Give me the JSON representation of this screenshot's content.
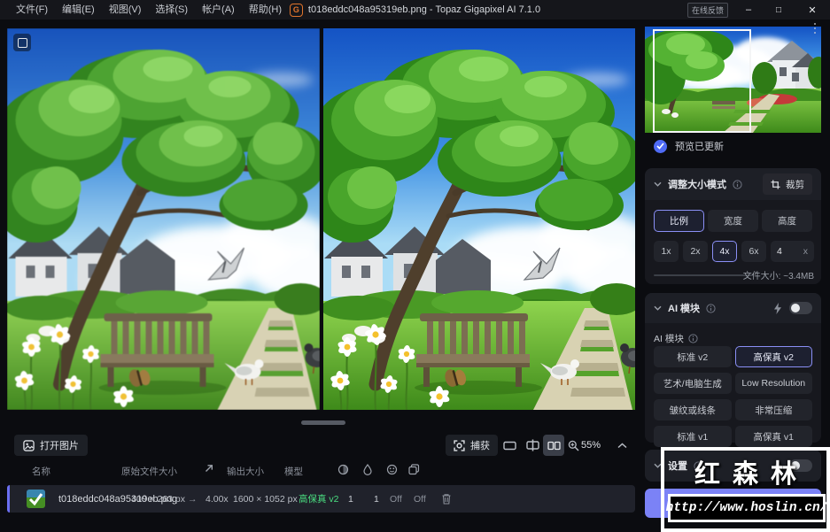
{
  "titlebar": {
    "menu": [
      {
        "label": "文件(F)"
      },
      {
        "label": "编辑(E)"
      },
      {
        "label": "视图(V)"
      },
      {
        "label": "选择(S)"
      },
      {
        "label": "帐户(A)"
      },
      {
        "label": "帮助(H)"
      }
    ],
    "app_icon_letter": "G",
    "title": "t018eddc048a95319eb.png - Topaz Gigapixel AI 7.1.0",
    "feedback_button": "在线反馈",
    "minimize_glyph": "–",
    "maximize_glyph": "□",
    "close_glyph": "✕"
  },
  "preview_status": {
    "label": "预览已更新"
  },
  "resize_panel": {
    "title": "调整大小模式",
    "crop_button": "裁剪",
    "tabs": [
      {
        "label": "比例",
        "selected": true
      },
      {
        "label": "宽度",
        "selected": false
      },
      {
        "label": "高度",
        "selected": false
      }
    ],
    "scale_buttons": [
      {
        "label": "1x",
        "selected": false
      },
      {
        "label": "2x",
        "selected": false
      },
      {
        "label": "4x",
        "selected": true
      },
      {
        "label": "6x",
        "selected": false
      }
    ],
    "custom_scale": {
      "value": "4",
      "suffix": "x"
    },
    "file_size": "文件大小: ~3.4MB"
  },
  "ai_panel": {
    "title": "AI 模块",
    "subtitle": "AI 模块",
    "models": [
      {
        "label": "标准 v2",
        "selected": false
      },
      {
        "label": "高保真 v2",
        "selected": true
      },
      {
        "label": "艺术/电脑生成",
        "selected": false
      },
      {
        "label": "Low Resolution",
        "selected": false
      },
      {
        "label": "皱纹或线条",
        "selected": false
      },
      {
        "label": "非常压缩",
        "selected": false
      },
      {
        "label": "标准 v1",
        "selected": false
      },
      {
        "label": "高保真 v1",
        "selected": false
      }
    ]
  },
  "settings_panel": {
    "title": "设置"
  },
  "footer_toolbar": {
    "open_image": "打开图片",
    "capture": "捕获",
    "zoom_level": "55%"
  },
  "queue_table": {
    "headers": {
      "name": "名称",
      "original_size": "原始文件大小",
      "output_size": "输出大小",
      "model": "模型"
    },
    "row": {
      "filename": "t018eddc048a95319eb.png",
      "original_size": "400 × 263 px",
      "arrow": "→",
      "scale_factor": "4.00x",
      "output_size": "1600 × 1052 px",
      "model": "高保真 v2",
      "denoise": "1",
      "deblur": "1",
      "face_recovery": "Off",
      "compression": "Off"
    }
  },
  "watermark": {
    "title": "红森林",
    "url": "http://www.hoslin.cn/"
  },
  "colors": {
    "accent": "#7b82f6",
    "selected_border": "#8a8ff5",
    "model_green": "#4ade80"
  }
}
